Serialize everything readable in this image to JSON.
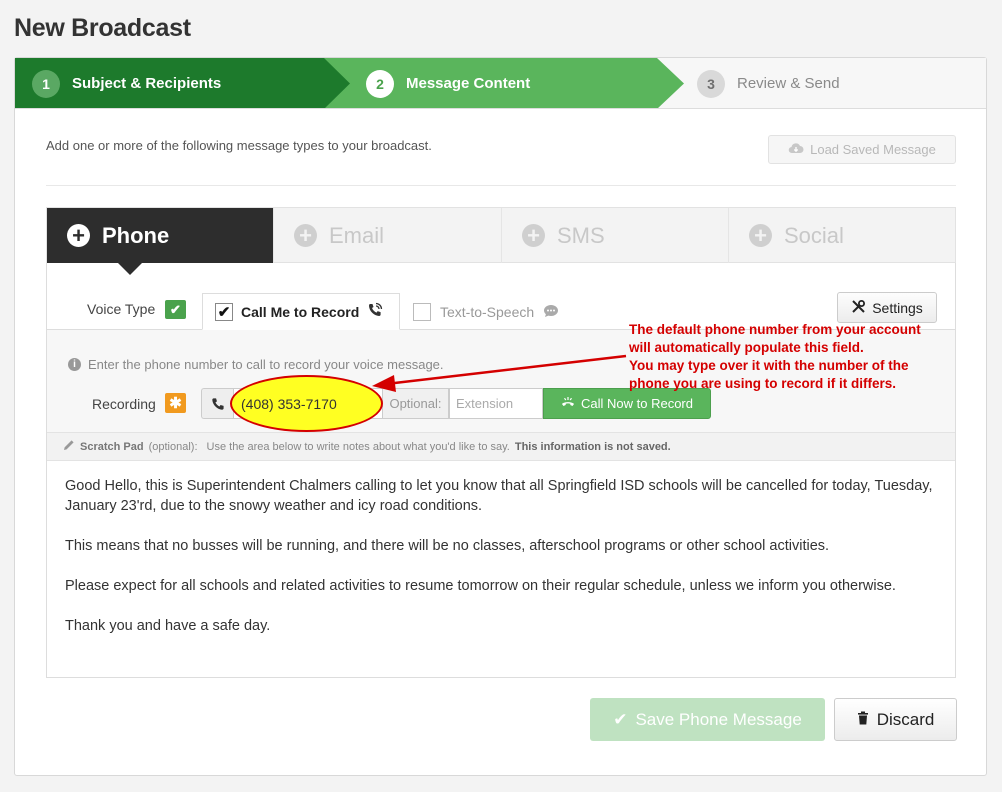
{
  "page": {
    "title": "New Broadcast"
  },
  "steps": [
    {
      "num": "1",
      "label": "Subject & Recipients"
    },
    {
      "num": "2",
      "label": "Message Content"
    },
    {
      "num": "3",
      "label": "Review & Send"
    }
  ],
  "intro_text": "Add one or more of the following message types to your broadcast.",
  "load_saved_label": "Load Saved Message",
  "tabs": [
    {
      "label": "Phone"
    },
    {
      "label": "Email"
    },
    {
      "label": "SMS"
    },
    {
      "label": "Social"
    }
  ],
  "voice": {
    "type_label": "Voice Type",
    "call_me_label": "Call Me to Record",
    "tts_label": "Text-to-Speech",
    "settings_label": "Settings"
  },
  "recording": {
    "info_text": "Enter the phone number to call to record your voice message.",
    "label": "Recording",
    "phone_value": "(408) 353-7170",
    "optional_label": "Optional:",
    "extension_placeholder": "Extension",
    "call_now_label": "Call Now to Record"
  },
  "scratch": {
    "title": "Scratch Pad",
    "optional": "(optional):",
    "hint": "Use the area below to write notes about what you'd like to say.",
    "warning": "This information is not saved."
  },
  "message": {
    "p1": "Good Hello, this is Superintendent Chalmers calling to let you know that all Springfield ISD schools will be cancelled for today, Tuesday, January 23'rd, due to the snowy weather and icy road conditions.",
    "p2": "This means that no busses will be running, and there will be no classes, afterschool programs or other school activities.",
    "p3": "Please expect for all schools and related activities to resume tomorrow on their regular schedule, unless we inform you otherwise.",
    "p4": "Thank you and have a safe day."
  },
  "annotation": {
    "line1": "The default phone number from your account",
    "line2": "will automatically populate this field.",
    "line3": "You may type over it with the number of the",
    "line4": "phone you are using to record if it differs."
  },
  "footer": {
    "save_label": "Save Phone Message",
    "discard_label": "Discard"
  },
  "colors": {
    "step_active_dark": "#1d7a2c",
    "step_active": "#5ab55c",
    "annotation_red": "#d40000",
    "highlight_yellow": "#ffff22"
  }
}
